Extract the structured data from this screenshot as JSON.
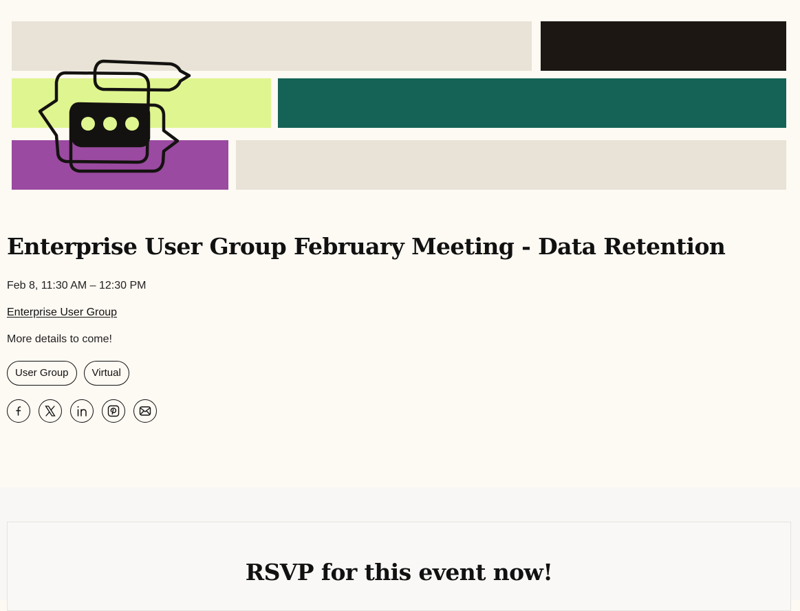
{
  "colors": {
    "page_background": "#fdf9f3",
    "banner_beige": "#e8e3d6",
    "banner_black": "#1c1712",
    "banner_lime": "#dff590",
    "banner_teal": "#146356",
    "banner_purple": "#9a4aa0",
    "text": "#111111"
  },
  "hero": {
    "icon": "chat-bubbles-illustration"
  },
  "event": {
    "title": "Enterprise User Group February Meeting - Data Retention",
    "date": "Feb 8, 11:30 AM – 12:30 PM",
    "group_link": "Enterprise User Group",
    "description": "More details to come!",
    "tags": [
      "User Group",
      "Virtual"
    ]
  },
  "share": [
    {
      "icon": "facebook-icon"
    },
    {
      "icon": "x-icon"
    },
    {
      "icon": "linkedin-icon"
    },
    {
      "icon": "pinterest-icon"
    },
    {
      "icon": "email-icon"
    }
  ],
  "rsvp": {
    "title": "RSVP for this event now!"
  }
}
